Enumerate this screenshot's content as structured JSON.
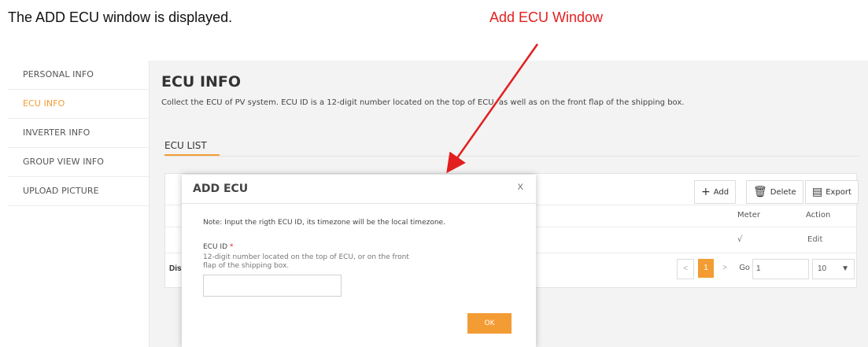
{
  "caption": "The ADD ECU window is displayed.",
  "annotation": "Add ECU Window",
  "sidebar": {
    "items": [
      {
        "label": "PERSONAL INFO",
        "active": false
      },
      {
        "label": "ECU INFO",
        "active": true
      },
      {
        "label": "INVERTER INFO",
        "active": false
      },
      {
        "label": "GROUP VIEW INFO",
        "active": false
      },
      {
        "label": "UPLOAD PICTURE",
        "active": false
      }
    ]
  },
  "main": {
    "title": "ECU INFO",
    "description": "Collect the ECU of PV system. ECU ID is a 12-digit number located on the top of ECU, as well as on the front flap of the shipping box.",
    "tab": "ECU LIST"
  },
  "toolbar": {
    "add_label": "Add",
    "delete_label": "Delete",
    "export_label": "Export"
  },
  "table": {
    "headers": {
      "meter": "Meter",
      "action": "Action"
    },
    "row": {
      "meter": "√",
      "action": "Edit"
    },
    "display_text": "Dis"
  },
  "pagination": {
    "current_page": "1",
    "go_label": "Go",
    "go_value": "1",
    "page_size": "10"
  },
  "modal": {
    "title": "ADD ECU",
    "close": "X",
    "note": "Note:   Input the rigth ECU ID, its timezone will be the local timezone.",
    "field_label": "ECU ID",
    "required_mark": "*",
    "field_help": "12-digit number located on the top of ECU, or on the front flap of the shipping box.",
    "field_value": "",
    "ok_label": "OK"
  },
  "colors": {
    "accent": "#f39c34",
    "annotation": "#e31e1e"
  }
}
